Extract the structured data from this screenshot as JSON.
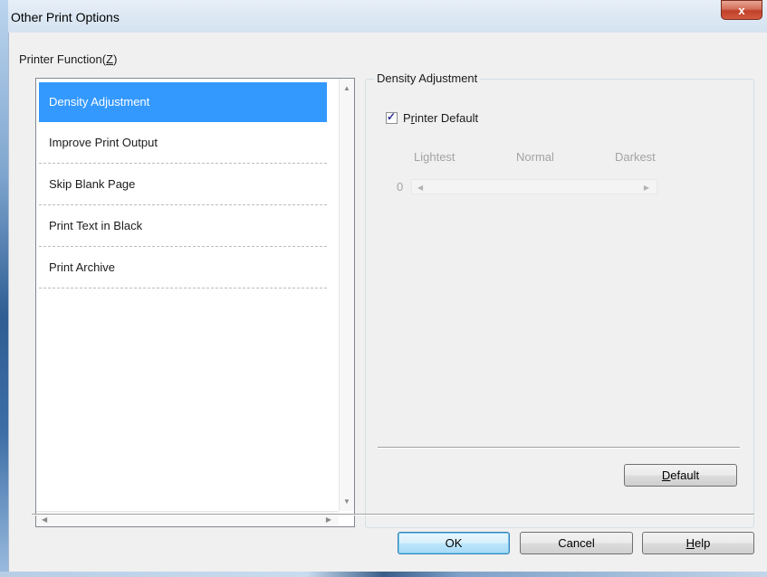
{
  "window": {
    "title": "Other Print Options",
    "close_glyph": "x"
  },
  "printer_function": {
    "label": "Printer Function",
    "accel": "Z",
    "items": [
      {
        "label": "Density Adjustment",
        "selected": true
      },
      {
        "label": "Improve Print Output",
        "selected": false
      },
      {
        "label": "Skip Blank Page",
        "selected": false
      },
      {
        "label": "Print Text in Black",
        "selected": false
      },
      {
        "label": "Print Archive",
        "selected": false
      }
    ]
  },
  "density": {
    "group_title": "Density Adjustment",
    "printer_default": {
      "label_prefix": "P",
      "label_accel": "r",
      "label_rest": "inter Default",
      "checked": true
    },
    "scale_labels": {
      "lightest": "Lightest",
      "normal": "Normal",
      "darkest": "Darkest"
    },
    "value": "0",
    "default_button": {
      "accel": "D",
      "rest": "efault"
    }
  },
  "buttons": {
    "ok": "OK",
    "cancel": "Cancel",
    "help": {
      "accel": "H",
      "rest": "elp"
    }
  },
  "colors": {
    "selection": "#3399ff",
    "dialog_bg": "#f0f0f0"
  }
}
